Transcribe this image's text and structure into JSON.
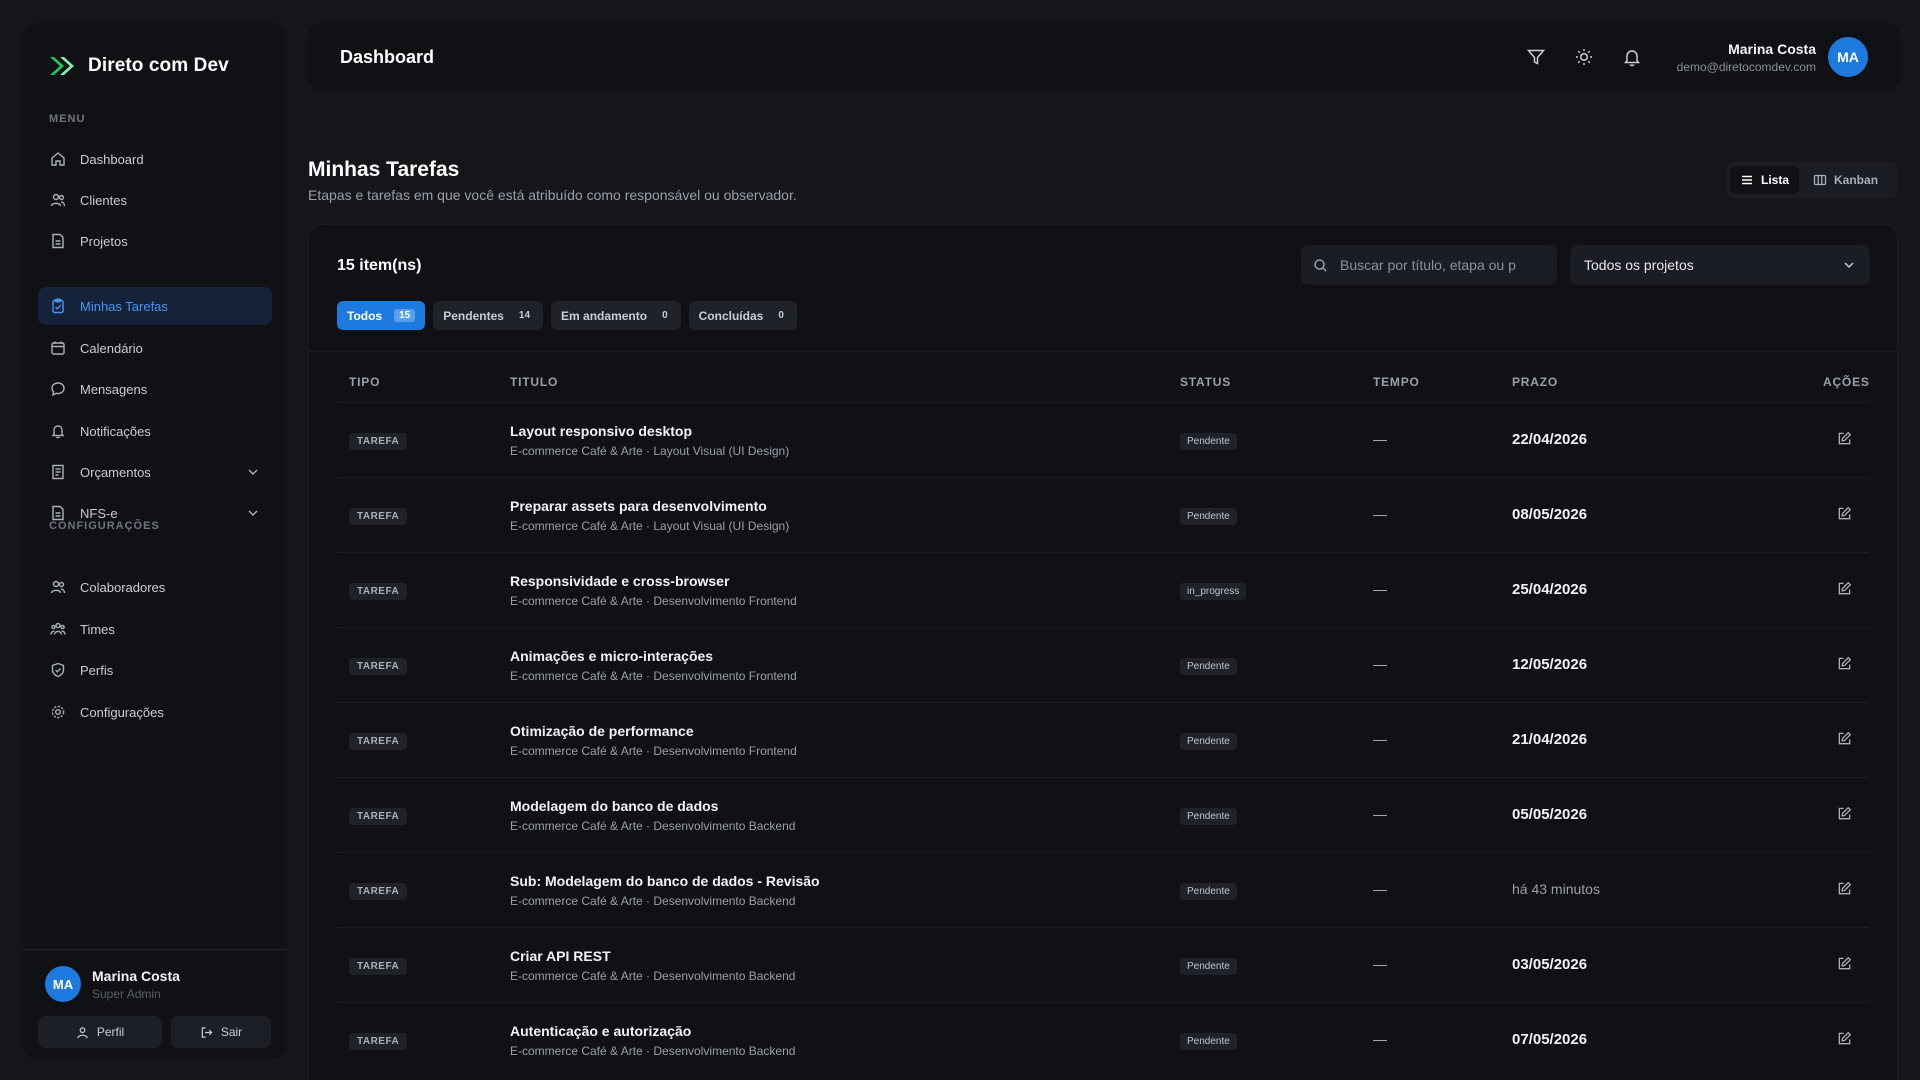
{
  "brand": {
    "name": "Direto com Dev",
    "accent": "#22c55e"
  },
  "sidebar": {
    "menu_label": "MENU",
    "items": [
      {
        "label": "Dashboard",
        "icon": "home-icon"
      },
      {
        "label": "Clientes",
        "icon": "users-icon"
      },
      {
        "label": "Projetos",
        "icon": "file-icon"
      },
      {
        "label": "Minhas Tarefas",
        "icon": "clipboard-icon",
        "active": true
      },
      {
        "label": "Calendário",
        "icon": "calendar-icon"
      },
      {
        "label": "Mensagens",
        "icon": "message-icon"
      },
      {
        "label": "Notificações",
        "icon": "bell-icon"
      },
      {
        "label": "Orçamentos",
        "icon": "receipt-icon",
        "expandable": true
      },
      {
        "label": "NFS-e",
        "icon": "file-icon",
        "expandable": true
      }
    ],
    "config_label": "CONFIGURAÇÕES",
    "config_items": [
      {
        "label": "Colaboradores",
        "icon": "users-icon"
      },
      {
        "label": "Times",
        "icon": "team-icon"
      },
      {
        "label": "Perfis",
        "icon": "shield-icon"
      },
      {
        "label": "Configurações",
        "icon": "gear-icon"
      }
    ],
    "footer": {
      "initials": "MA",
      "name": "Marina Costa",
      "role": "Super Admin",
      "profile_label": "Perfil",
      "logout_label": "Sair"
    }
  },
  "header": {
    "title": "Dashboard",
    "user": {
      "name": "Marina Costa",
      "email": "demo@diretocomdev.com",
      "initials": "MA"
    }
  },
  "page": {
    "title": "Minhas Tarefas",
    "subtitle": "Etapas e tarefas em que você está atribuído como responsável ou observador.",
    "view": {
      "list_label": "Lista",
      "kanban_label": "Kanban"
    }
  },
  "card": {
    "count": "15 item(ns)",
    "search_placeholder": "Buscar por título, etapa ou p",
    "project_filter": "Todos os projetos",
    "filters": [
      {
        "label": "Todos",
        "count": "15",
        "active": true
      },
      {
        "label": "Pendentes",
        "count": "14"
      },
      {
        "label": "Em andamento",
        "count": "0"
      },
      {
        "label": "Concluídas",
        "count": "0"
      }
    ],
    "columns": {
      "tipo": "TIPO",
      "titulo": "TITULO",
      "status": "STATUS",
      "tempo": "TEMPO",
      "prazo": "PRAZO",
      "acoes": "AÇÕES"
    },
    "rows": [
      {
        "tipo": "TAREFA",
        "title": "Layout responsivo desktop",
        "sub": "E-commerce Café & Arte · Layout Visual (UI Design)",
        "status": "Pendente",
        "tempo": "—",
        "prazo": "22/04/2026"
      },
      {
        "tipo": "TAREFA",
        "title": "Preparar assets para desenvolvimento",
        "sub": "E-commerce Café & Arte · Layout Visual (UI Design)",
        "status": "Pendente",
        "tempo": "—",
        "prazo": "08/05/2026"
      },
      {
        "tipo": "TAREFA",
        "title": "Responsividade e cross-browser",
        "sub": "E-commerce Café & Arte · Desenvolvimento Frontend",
        "status": "in_progress",
        "tempo": "—",
        "prazo": "25/04/2026"
      },
      {
        "tipo": "TAREFA",
        "title": "Animações e micro-interações",
        "sub": "E-commerce Café & Arte · Desenvolvimento Frontend",
        "status": "Pendente",
        "tempo": "—",
        "prazo": "12/05/2026"
      },
      {
        "tipo": "TAREFA",
        "title": "Otimização de performance",
        "sub": "E-commerce Café & Arte · Desenvolvimento Frontend",
        "status": "Pendente",
        "tempo": "—",
        "prazo": "21/04/2026"
      },
      {
        "tipo": "TAREFA",
        "title": "Modelagem do banco de dados",
        "sub": "E-commerce Café & Arte · Desenvolvimento Backend",
        "status": "Pendente",
        "tempo": "—",
        "prazo": "05/05/2026"
      },
      {
        "tipo": "TAREFA",
        "title": "Sub: Modelagem do banco de dados - Revisão",
        "sub": "E-commerce Café & Arte · Desenvolvimento Backend",
        "status": "Pendente",
        "tempo": "—",
        "prazo": "há 43 minutos",
        "relative": true
      },
      {
        "tipo": "TAREFA",
        "title": "Criar API REST",
        "sub": "E-commerce Café & Arte · Desenvolvimento Backend",
        "status": "Pendente",
        "tempo": "—",
        "prazo": "03/05/2026"
      },
      {
        "tipo": "TAREFA",
        "title": "Autenticação e autorização",
        "sub": "E-commerce Café & Arte · Desenvolvimento Backend",
        "status": "Pendente",
        "tempo": "—",
        "prazo": "07/05/2026"
      }
    ]
  }
}
